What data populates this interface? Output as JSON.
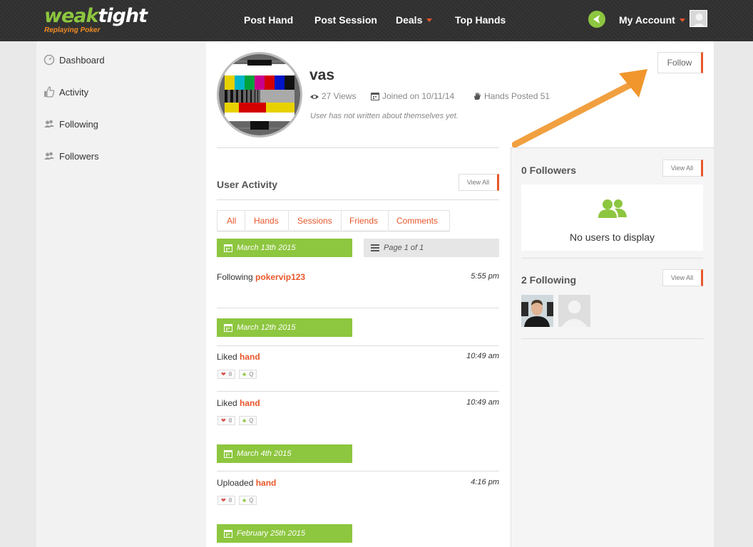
{
  "brand": {
    "name_part1": "weak",
    "name_part2": "tight",
    "tagline": "Replaying Poker"
  },
  "nav": {
    "post_hand": "Post Hand",
    "post_session": "Post Session",
    "deals": "Deals",
    "top_hands": "Top Hands",
    "my_account": "My Account"
  },
  "sidebar": {
    "items": [
      {
        "label": "Dashboard"
      },
      {
        "label": "Activity"
      },
      {
        "label": "Following"
      },
      {
        "label": "Followers"
      }
    ]
  },
  "profile": {
    "username": "vas",
    "views": "27 Views",
    "joined": "Joined on 10/11/14",
    "hands_posted": "Hands Posted 51",
    "about": "User has not written about themselves yet.",
    "follow_label": "Follow"
  },
  "activity": {
    "title": "User Activity",
    "view_all": "View All",
    "tabs": [
      "All",
      "Hands",
      "Sessions",
      "Friends",
      "Comments"
    ],
    "page_info": "Page 1 of 1",
    "groups": [
      {
        "date": "March 13th 2015",
        "entries": [
          {
            "action": "Following",
            "link": "pokervip123",
            "time": "5:55 pm"
          }
        ]
      },
      {
        "date": "March 12th 2015",
        "entries": [
          {
            "action": "Liked",
            "link": "hand",
            "time": "10:49 am",
            "likes": "8",
            "card": "Q"
          },
          {
            "action": "Liked",
            "link": "hand",
            "time": "10:49 am",
            "likes": "8",
            "card": "Q"
          }
        ]
      },
      {
        "date": "March 4th 2015",
        "entries": [
          {
            "action": "Uploaded",
            "link": "hand",
            "time": "4:16 pm",
            "likes": "8",
            "card": "Q"
          }
        ]
      },
      {
        "date": "February 25th 2015",
        "entries": []
      }
    ]
  },
  "followers": {
    "title": "0 Followers",
    "view_all": "View All",
    "empty_text": "No users to display"
  },
  "following": {
    "title": "2 Following",
    "view_all": "View All"
  },
  "colors": {
    "accent": "#e8572a",
    "green": "#8dc63f",
    "topbar": "#333333"
  }
}
